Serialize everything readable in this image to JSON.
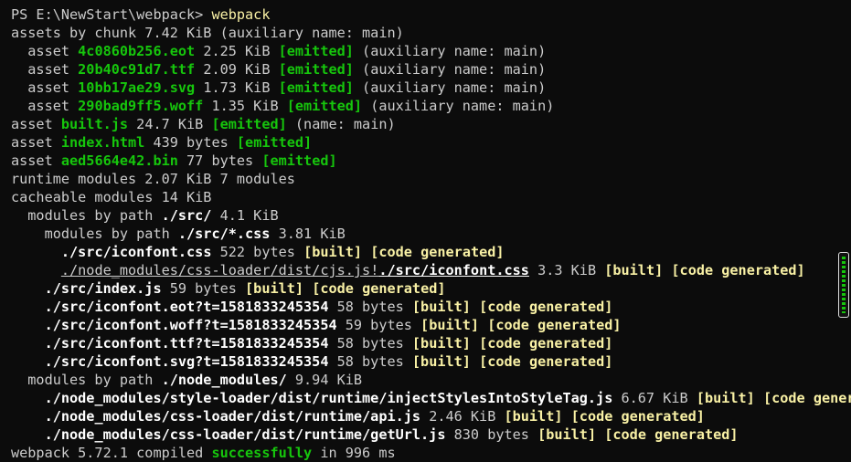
{
  "lines": [
    [
      {
        "t": "PS E:\\NewStart\\webpack> ",
        "c": "w"
      },
      {
        "t": "webpack",
        "c": "y"
      }
    ],
    [
      {
        "t": "assets by chunk 7.42 KiB (auxiliary name: main)",
        "c": "w"
      }
    ],
    [
      {
        "t": "  asset ",
        "c": "w"
      },
      {
        "t": "4c0860b256.eot",
        "c": "gb"
      },
      {
        "t": " 2.25 KiB ",
        "c": "w"
      },
      {
        "t": "[emitted]",
        "c": "gb"
      },
      {
        "t": " (auxiliary name: main)",
        "c": "w"
      }
    ],
    [
      {
        "t": "  asset ",
        "c": "w"
      },
      {
        "t": "20b40c91d7.ttf",
        "c": "gb"
      },
      {
        "t": " 2.09 KiB ",
        "c": "w"
      },
      {
        "t": "[emitted]",
        "c": "gb"
      },
      {
        "t": " (auxiliary name: main)",
        "c": "w"
      }
    ],
    [
      {
        "t": "  asset ",
        "c": "w"
      },
      {
        "t": "10bb17ae29.svg",
        "c": "gb"
      },
      {
        "t": " 1.73 KiB ",
        "c": "w"
      },
      {
        "t": "[emitted]",
        "c": "gb"
      },
      {
        "t": " (auxiliary name: main)",
        "c": "w"
      }
    ],
    [
      {
        "t": "  asset ",
        "c": "w"
      },
      {
        "t": "290bad9ff5.woff",
        "c": "gb"
      },
      {
        "t": " 1.35 KiB ",
        "c": "w"
      },
      {
        "t": "[emitted]",
        "c": "gb"
      },
      {
        "t": " (auxiliary name: main)",
        "c": "w"
      }
    ],
    [
      {
        "t": "asset ",
        "c": "w"
      },
      {
        "t": "built.js",
        "c": "gb"
      },
      {
        "t": " 24.7 KiB ",
        "c": "w"
      },
      {
        "t": "[emitted]",
        "c": "gb"
      },
      {
        "t": " (name: main)",
        "c": "w"
      }
    ],
    [
      {
        "t": "asset ",
        "c": "w"
      },
      {
        "t": "index.html",
        "c": "gb"
      },
      {
        "t": " 439 bytes ",
        "c": "w"
      },
      {
        "t": "[emitted]",
        "c": "gb"
      }
    ],
    [
      {
        "t": "asset ",
        "c": "w"
      },
      {
        "t": "aed5664e42.bin",
        "c": "gb"
      },
      {
        "t": " 77 bytes ",
        "c": "w"
      },
      {
        "t": "[emitted]",
        "c": "gb"
      }
    ],
    [
      {
        "t": "runtime modules 2.07 KiB 7 modules",
        "c": "w"
      }
    ],
    [
      {
        "t": "cacheable modules 14 KiB",
        "c": "w"
      }
    ],
    [
      {
        "t": "  modules by path ",
        "c": "w"
      },
      {
        "t": "./src/",
        "c": "b"
      },
      {
        "t": " 4.1 KiB",
        "c": "w"
      }
    ],
    [
      {
        "t": "    modules by path ",
        "c": "w"
      },
      {
        "t": "./src/*.css",
        "c": "b"
      },
      {
        "t": " 3.81 KiB",
        "c": "w"
      }
    ],
    [
      {
        "t": "      ",
        "c": "w"
      },
      {
        "t": "./src/iconfont.css",
        "c": "b"
      },
      {
        "t": " 522 bytes ",
        "c": "w"
      },
      {
        "t": "[built]",
        "c": "yb"
      },
      {
        "t": " ",
        "c": "w"
      },
      {
        "t": "[code generated]",
        "c": "yb"
      }
    ],
    [
      {
        "t": "      ",
        "c": "w"
      },
      {
        "t": "./node_modules/css-loader/dist/cjs.js!",
        "c": "u"
      },
      {
        "t": "./src/iconfont.css",
        "c": "ub"
      },
      {
        "t": " 3.3 KiB ",
        "c": "w"
      },
      {
        "t": "[built]",
        "c": "yb"
      },
      {
        "t": " ",
        "c": "w"
      },
      {
        "t": "[code generated]",
        "c": "yb"
      }
    ],
    [
      {
        "t": "    ",
        "c": "w"
      },
      {
        "t": "./src/index.js",
        "c": "b"
      },
      {
        "t": " 59 bytes ",
        "c": "w"
      },
      {
        "t": "[built]",
        "c": "yb"
      },
      {
        "t": " ",
        "c": "w"
      },
      {
        "t": "[code generated]",
        "c": "yb"
      }
    ],
    [
      {
        "t": "    ",
        "c": "w"
      },
      {
        "t": "./src/iconfont.eot?t=1581833245354",
        "c": "b"
      },
      {
        "t": " 58 bytes ",
        "c": "w"
      },
      {
        "t": "[built]",
        "c": "yb"
      },
      {
        "t": " ",
        "c": "w"
      },
      {
        "t": "[code generated]",
        "c": "yb"
      }
    ],
    [
      {
        "t": "    ",
        "c": "w"
      },
      {
        "t": "./src/iconfont.woff?t=1581833245354",
        "c": "b"
      },
      {
        "t": " 59 bytes ",
        "c": "w"
      },
      {
        "t": "[built]",
        "c": "yb"
      },
      {
        "t": " ",
        "c": "w"
      },
      {
        "t": "[code generated]",
        "c": "yb"
      }
    ],
    [
      {
        "t": "    ",
        "c": "w"
      },
      {
        "t": "./src/iconfont.ttf?t=1581833245354",
        "c": "b"
      },
      {
        "t": " 58 bytes ",
        "c": "w"
      },
      {
        "t": "[built]",
        "c": "yb"
      },
      {
        "t": " ",
        "c": "w"
      },
      {
        "t": "[code generated]",
        "c": "yb"
      }
    ],
    [
      {
        "t": "    ",
        "c": "w"
      },
      {
        "t": "./src/iconfont.svg?t=1581833245354",
        "c": "b"
      },
      {
        "t": " 58 bytes ",
        "c": "w"
      },
      {
        "t": "[built]",
        "c": "yb"
      },
      {
        "t": " ",
        "c": "w"
      },
      {
        "t": "[code generated]",
        "c": "yb"
      }
    ],
    [
      {
        "t": "  modules by path ",
        "c": "w"
      },
      {
        "t": "./node_modules/",
        "c": "b"
      },
      {
        "t": " 9.94 KiB",
        "c": "w"
      }
    ],
    [
      {
        "t": "    ",
        "c": "w"
      },
      {
        "t": "./node_modules/style-loader/dist/runtime/injectStylesIntoStyleTag.js",
        "c": "b"
      },
      {
        "t": " 6.67 KiB ",
        "c": "w"
      },
      {
        "t": "[built]",
        "c": "yb"
      },
      {
        "t": " ",
        "c": "w"
      },
      {
        "t": "[code genera",
        "c": "yb"
      }
    ],
    [
      {
        "t": "    ",
        "c": "w"
      },
      {
        "t": "./node_modules/css-loader/dist/runtime/api.js",
        "c": "b"
      },
      {
        "t": " 2.46 KiB ",
        "c": "w"
      },
      {
        "t": "[built]",
        "c": "yb"
      },
      {
        "t": " ",
        "c": "w"
      },
      {
        "t": "[code generated]",
        "c": "yb"
      }
    ],
    [
      {
        "t": "    ",
        "c": "w"
      },
      {
        "t": "./node_modules/css-loader/dist/runtime/getUrl.js",
        "c": "b"
      },
      {
        "t": " 830 bytes ",
        "c": "w"
      },
      {
        "t": "[built]",
        "c": "yb"
      },
      {
        "t": " ",
        "c": "w"
      },
      {
        "t": "[code generated]",
        "c": "yb"
      }
    ],
    [
      {
        "t": "webpack 5.72.1 compiled ",
        "c": "w"
      },
      {
        "t": "successfully",
        "c": "gb"
      },
      {
        "t": " in 996 ms",
        "c": "w"
      }
    ]
  ],
  "colors": {
    "background": "#0c0c0c",
    "text": "#cccccc",
    "command": "#f9f1a5",
    "success": "#16c60c",
    "path": "#ffffff"
  }
}
